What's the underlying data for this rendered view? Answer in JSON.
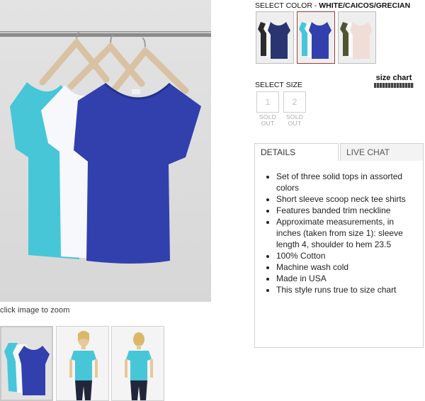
{
  "product_image": {
    "zoom_hint": "click image to zoom"
  },
  "thumbnails": [
    {
      "name": "set-of-three-tops"
    },
    {
      "name": "model-front"
    },
    {
      "name": "model-back"
    }
  ],
  "color": {
    "label": "SELECT COLOR - ",
    "selected": "WHITE/CAICOS/GRECIAN",
    "swatches": [
      {
        "name": "black-white-navy"
      },
      {
        "name": "white-caicos-grecian"
      },
      {
        "name": "olive-white-blush"
      }
    ]
  },
  "size_chart_label": "size chart",
  "size": {
    "label": "SELECT SIZE",
    "options": [
      {
        "value": "1",
        "status": "SOLD\nOUT"
      },
      {
        "value": "2",
        "status": "SOLD\nOUT"
      }
    ]
  },
  "tabs": {
    "details": "DETAILS",
    "chat": "LIVE CHAT"
  },
  "details": [
    "Set of three solid tops in assorted colors",
    "Short sleeve scoop neck tee shirts",
    "Features banded trim neckline",
    "Approximate measurements, in inches (taken from size 1): sleeve length 4, shoulder to hem 23.5",
    "100% Cotton",
    "Machine wash cold",
    "Made in USA",
    "This style runs true to size chart"
  ],
  "colors": {
    "turquoise": "#47c6d8",
    "white_tee": "#f7f8fb",
    "royal_blue": "#3140ad",
    "navy": "#2a3470",
    "black": "#2b2b2b",
    "olive": "#4f5531",
    "blush": "#f1ddd8",
    "hanger_wood": "#d8c2a3"
  }
}
